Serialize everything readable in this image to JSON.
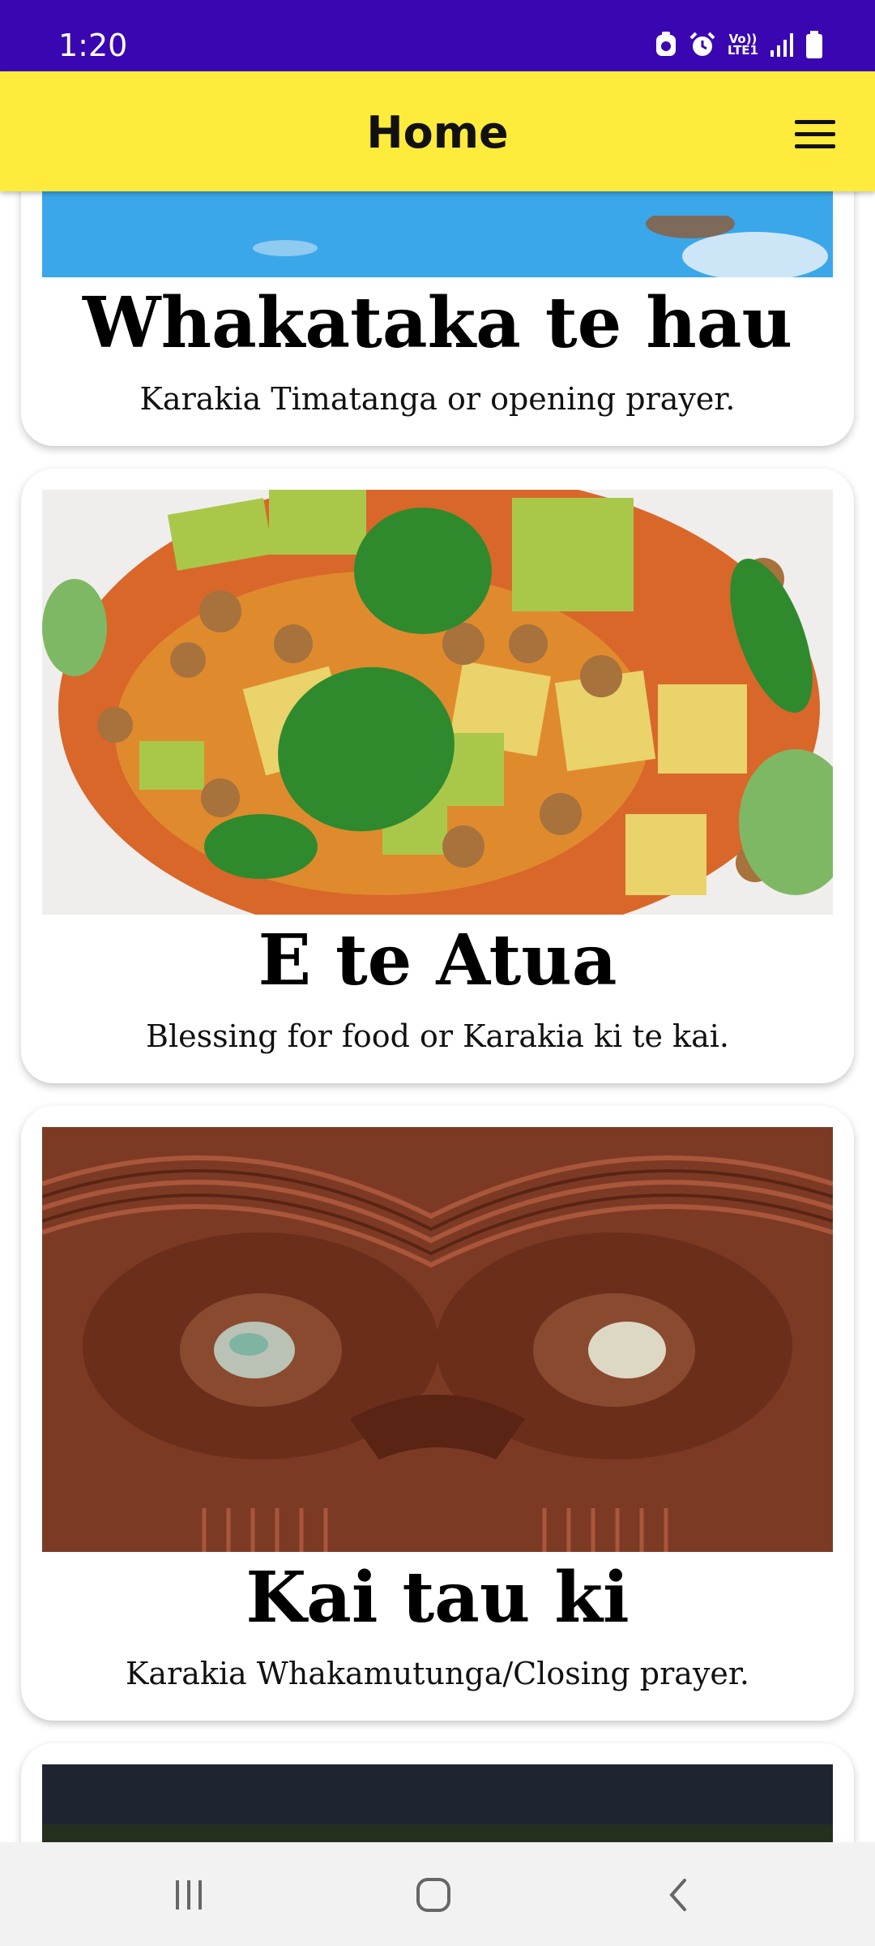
{
  "status_bar": {
    "time": "1:20",
    "lte_label": "Vo))\nLTE1",
    "icons": [
      "app-notification-icon",
      "alarm-icon",
      "volte-lte-icon",
      "signal-icon",
      "battery-icon"
    ]
  },
  "app_bar": {
    "title": "Home",
    "menu_icon": "hamburger-menu-icon",
    "background": "#ffeb3b"
  },
  "cards": [
    {
      "title": "Whakataka te hau",
      "description": "Karakia Timatanga or opening prayer.",
      "image": "sky-with-clouds"
    },
    {
      "title": "E te Atua",
      "description": "Blessing for food or Karakia ki te kai.",
      "image": "pumpkin-chickpea-avocado-salad"
    },
    {
      "title": "Kai tau ki",
      "description": "Karakia Whakamutunga/Closing prayer.",
      "image": "maori-carving-paua-eyes"
    },
    {
      "title": "",
      "description": "",
      "image": "dark-screenshot"
    }
  ],
  "nav_bar": {
    "buttons": [
      "recent-apps-icon",
      "home-icon",
      "back-icon"
    ]
  },
  "colors": {
    "status_bar": "#3a06b2",
    "app_bar": "#ffeb3b",
    "card_background": "#ffffff"
  }
}
